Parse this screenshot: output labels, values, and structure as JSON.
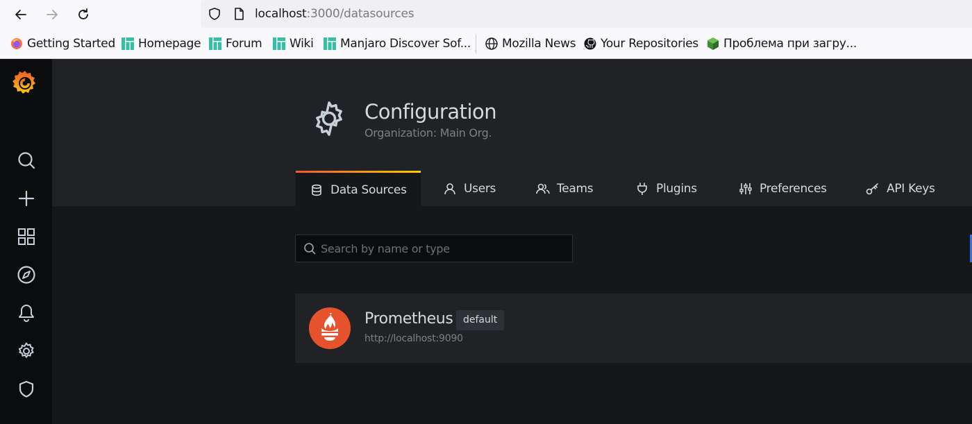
{
  "browser": {
    "url_host": "localhost",
    "url_path": ":3000/datasources"
  },
  "bookmarks": [
    {
      "label": "Getting Started",
      "icon": "firefox-icon"
    },
    {
      "label": "Homepage",
      "icon": "manjaro-icon"
    },
    {
      "label": "Forum",
      "icon": "manjaro-icon"
    },
    {
      "label": "Wiki",
      "icon": "manjaro-icon"
    },
    {
      "label": "Manjaro Discover Sof...",
      "icon": "manjaro-icon"
    },
    {
      "label": "Mozilla News",
      "icon": "globe-icon"
    },
    {
      "label": "Your Repositories",
      "icon": "github-icon"
    },
    {
      "label": "Проблема при загру...",
      "icon": "cube-icon"
    }
  ],
  "sidemenu": {
    "items": [
      "grafana-logo-icon",
      "search-icon",
      "plus-icon",
      "dashboards-icon",
      "explore-icon",
      "alerting-icon",
      "configuration-icon",
      "server-admin-icon"
    ]
  },
  "header": {
    "title": "Configuration",
    "subtitle": "Organization: Main Org."
  },
  "tabs": [
    {
      "label": "Data Sources",
      "icon": "database-icon",
      "active": true
    },
    {
      "label": "Users",
      "icon": "user-icon"
    },
    {
      "label": "Teams",
      "icon": "users-icon"
    },
    {
      "label": "Plugins",
      "icon": "plug-icon"
    },
    {
      "label": "Preferences",
      "icon": "sliders-icon"
    },
    {
      "label": "API Keys",
      "icon": "key-icon"
    }
  ],
  "search": {
    "placeholder": "Search by name or type"
  },
  "datasources": [
    {
      "name": "Prometheus",
      "badge": "default",
      "url": "http://localhost:9090"
    }
  ],
  "colors": {
    "accent_start": "#f05a28",
    "accent_end": "#fbca0a",
    "prometheus": "#e6522c",
    "background": "#161719",
    "panel": "#202226"
  }
}
